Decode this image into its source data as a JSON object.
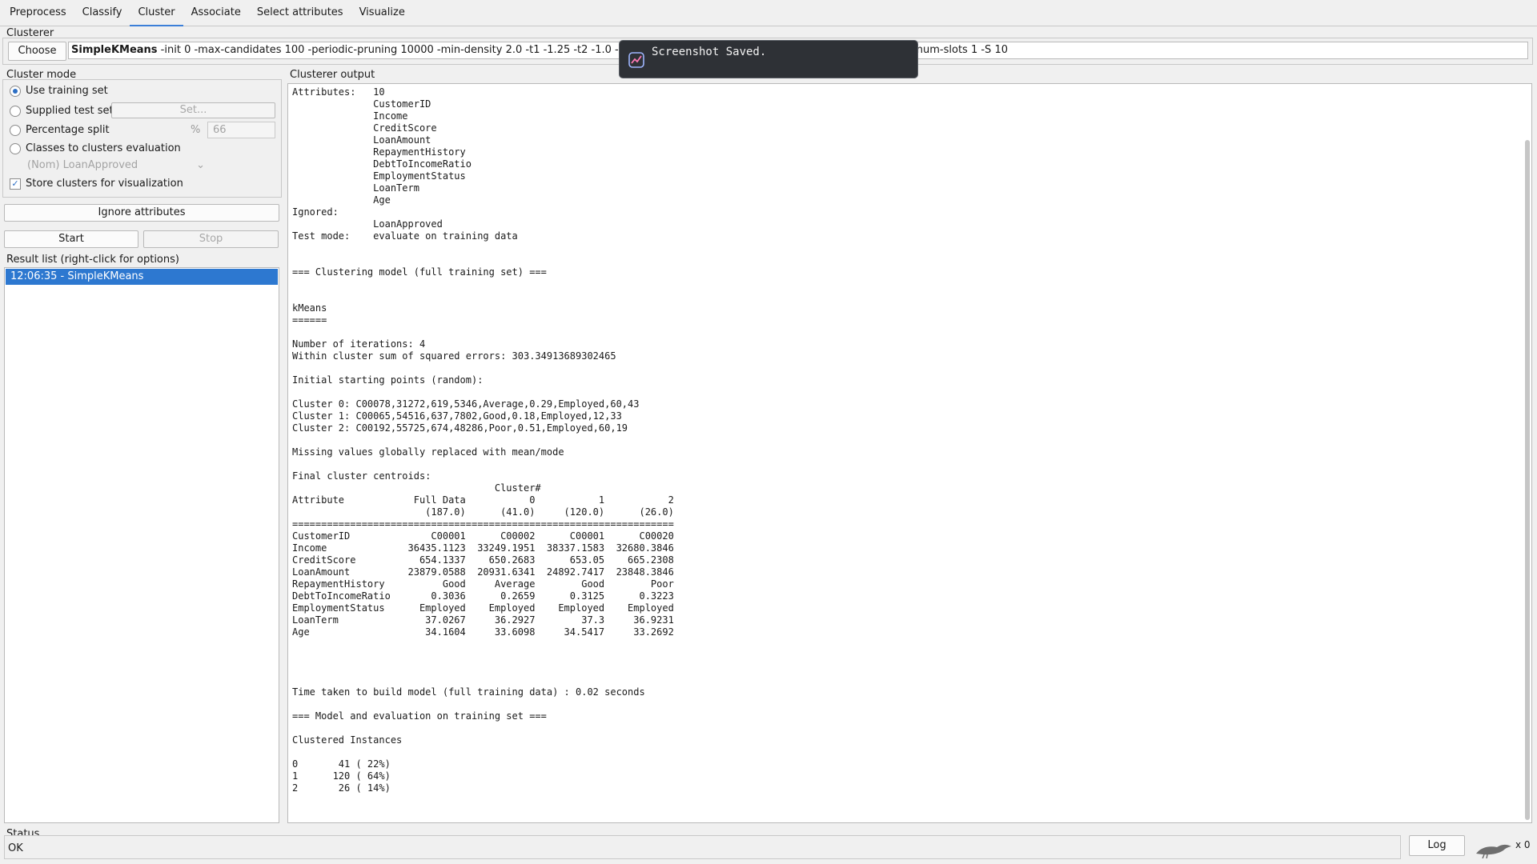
{
  "tabs": [
    "Preprocess",
    "Classify",
    "Cluster",
    "Associate",
    "Select attributes",
    "Visualize"
  ],
  "clusterer": {
    "group_label": "Clusterer",
    "choose_label": "Choose",
    "algorithm": "SimpleKMeans",
    "options": " -init 0 -max-candidates 100 -periodic-pruning 10000 -min-density 2.0 -t1 -1.25 -t2 -1.0 -N 3 -A \"weka.core.EuclideanDistance -R first-last\" -I 500 -num-slots 1 -S 10"
  },
  "cluster_mode": {
    "group_label": "Cluster mode",
    "use_training_set": "Use training set",
    "supplied_test_set": "Supplied test set",
    "set_label": "Set...",
    "percentage_split": "Percentage split",
    "percent_symbol": "%",
    "percent_value": "66",
    "classes_to_clusters": "Classes to clusters evaluation",
    "class_attribute": "(Nom) LoanApproved",
    "store_clusters": "Store clusters for visualization",
    "selected_mode": "Use training set",
    "store_clusters_checked": true
  },
  "ignore_attributes_label": "Ignore attributes",
  "start_label": "Start",
  "stop_label": "Stop",
  "result_list": {
    "label": "Result list (right-click for options)",
    "items": [
      "12:06:35 - SimpleKMeans"
    ]
  },
  "output": {
    "label": "Clusterer output",
    "text": "Attributes:   10\n              CustomerID\n              Income\n              CreditScore\n              LoanAmount\n              RepaymentHistory\n              DebtToIncomeRatio\n              EmploymentStatus\n              LoanTerm\n              Age\nIgnored:\n              LoanApproved\nTest mode:    evaluate on training data\n\n\n=== Clustering model (full training set) ===\n\n\nkMeans\n======\n\nNumber of iterations: 4\nWithin cluster sum of squared errors: 303.34913689302465\n\nInitial starting points (random):\n\nCluster 0: C00078,31272,619,5346,Average,0.29,Employed,60,43\nCluster 1: C00065,54516,637,7802,Good,0.18,Employed,12,33\nCluster 2: C00192,55725,674,48286,Poor,0.51,Employed,60,19\n\nMissing values globally replaced with mean/mode\n\nFinal cluster centroids:\n                                   Cluster#\nAttribute            Full Data           0           1           2\n                       (187.0)      (41.0)     (120.0)      (26.0)\n==================================================================\nCustomerID              C00001      C00002      C00001      C00020\nIncome              36435.1123  33249.1951  38337.1583  32680.3846\nCreditScore           654.1337    650.2683      653.05    665.2308\nLoanAmount          23879.0588  20931.6341  24892.7417  23848.3846\nRepaymentHistory          Good     Average        Good        Poor\nDebtToIncomeRatio       0.3036      0.2659      0.3125      0.3223\nEmploymentStatus      Employed    Employed    Employed    Employed\nLoanTerm               37.0267     36.2927        37.3     36.9231\nAge                    34.1604     33.6098     34.5417     33.2692\n\n\n\n\nTime taken to build model (full training data) : 0.02 seconds\n\n=== Model and evaluation on training set ===\n\nClustered Instances\n\n0       41 ( 22%)\n1      120 ( 64%)\n2       26 ( 14%)"
  },
  "status": {
    "group_label": "Status",
    "text": "OK"
  },
  "log_label": "Log",
  "task_count": "x 0",
  "toast": {
    "message": "Screenshot Saved."
  },
  "colors": {
    "selection": "#2d78d0",
    "toast_bg": "#2e3136",
    "tab_active": "#3c7fd8"
  }
}
